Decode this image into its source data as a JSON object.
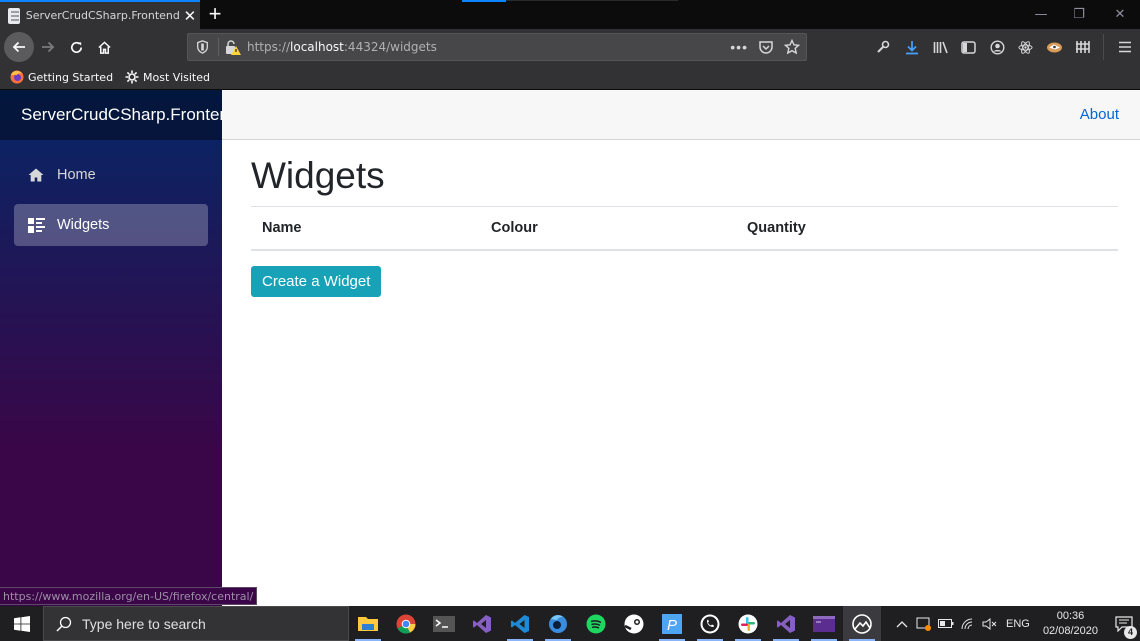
{
  "browser": {
    "tab": {
      "title": "ServerCrudCSharp.Frontend",
      "close_label": "✕"
    },
    "new_tab_label": "+",
    "window_controls": {
      "minimize": "—",
      "restore": "❐",
      "close": "✕"
    },
    "url": {
      "scheme": "https://",
      "host": "localhost",
      "rest": ":44324/widgets"
    },
    "bookmarks": [
      {
        "label": "Getting Started",
        "icon": "firefox-icon"
      },
      {
        "label": "Most Visited",
        "icon": "gear-icon"
      }
    ],
    "toolbar_icons": [
      "wrench-icon",
      "download-icon",
      "library-icon",
      "sidebar-icon",
      "account-icon",
      "react-devtools-icon",
      "extension-icon",
      "containers-icon"
    ],
    "accent_color": "#0a84ff",
    "status_url": "https://www.mozilla.org/en-US/firefox/central/"
  },
  "app": {
    "brand": "ServerCrudCSharp.Frontend",
    "nav": [
      {
        "label": "Home",
        "icon": "home-icon",
        "active": false
      },
      {
        "label": "Widgets",
        "icon": "list-icon",
        "active": true
      }
    ],
    "top_links": {
      "about": "About"
    },
    "page_title": "Widgets",
    "table": {
      "columns": [
        "Name",
        "Colour",
        "Quantity"
      ],
      "rows": []
    },
    "create_button": "Create a Widget",
    "colors": {
      "button": "#17a2b8",
      "link": "#0366d6",
      "sidebar_top": "#052767",
      "sidebar_bottom": "#3a0647"
    }
  },
  "taskbar": {
    "search_placeholder": "Type here to search",
    "apps": [
      "file-explorer-icon",
      "chrome-icon",
      "terminal-icon",
      "visual-studio-icon",
      "vscode-icon",
      "firefox-dev-icon",
      "spotify-icon",
      "steam-icon",
      "p-app-icon",
      "whatsapp-icon",
      "slack-icon",
      "visual-studio-2-icon",
      "console-icon",
      "firefox-active-icon"
    ],
    "language": "ENG",
    "time": "00:36",
    "date": "02/08/2020",
    "notification_count": "4"
  }
}
